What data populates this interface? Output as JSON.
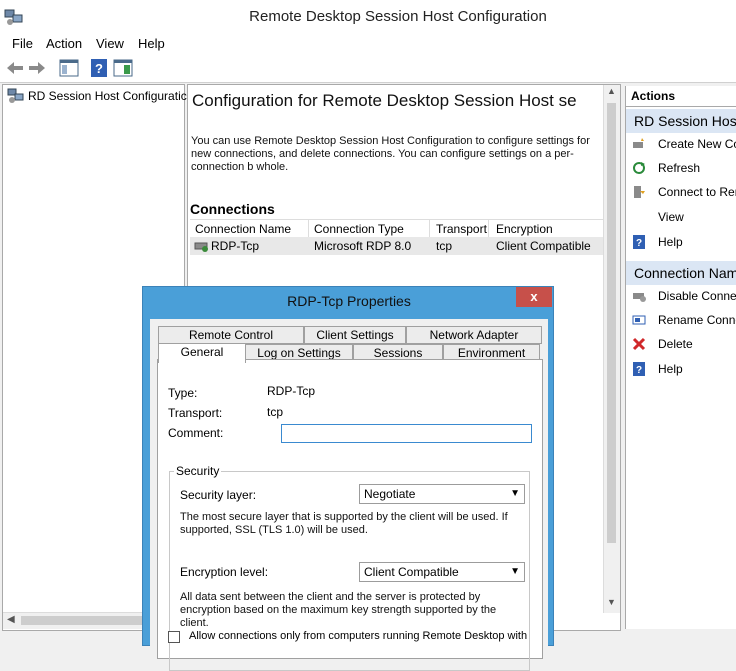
{
  "window": {
    "title": "Remote Desktop Session Host Configuration"
  },
  "menu": [
    "File",
    "Action",
    "View",
    "Help"
  ],
  "tree": {
    "root_label": "RD Session Host Configuratic"
  },
  "center": {
    "heading": "Configuration for Remote Desktop Session Host se",
    "intro": "You can use Remote Desktop Session Host Configuration to configure settings for new connections, and delete connections. You can configure settings on a per-connection b whole.",
    "connections_title": "Connections",
    "columns": [
      "Connection Name",
      "Connection Type",
      "Transport",
      "Encryption"
    ],
    "rows": [
      {
        "name": "RDP-Tcp",
        "type": "Microsoft RDP 8.0",
        "transport": "tcp",
        "encryption": "Client Compatible"
      }
    ]
  },
  "actions": {
    "header": "Actions",
    "section1": {
      "title": "RD Session Host",
      "items": [
        "Create New Co",
        "Refresh",
        "Connect to Rer",
        "View",
        "Help"
      ]
    },
    "section2": {
      "title": "Connection Nam",
      "items": [
        "Disable Connec",
        "Rename Conne",
        "Delete",
        "Help"
      ]
    }
  },
  "dialog": {
    "title": "RDP-Tcp Properties",
    "close_label": "x",
    "tabs_back": [
      "Remote Control",
      "Client Settings",
      "Network Adapter"
    ],
    "tabs_front": [
      "General",
      "Log on Settings",
      "Sessions",
      "Environment"
    ],
    "type_label": "Type:",
    "type_value": "RDP-Tcp",
    "transport_label": "Transport:",
    "transport_value": "tcp",
    "comment_label": "Comment:",
    "comment_value": "",
    "security_group": "Security",
    "security_layer_label": "Security layer:",
    "security_layer_value": "Negotiate",
    "security_layer_desc": "The most secure layer that is supported by the client will be used. If supported, SSL (TLS 1.0) will be used.",
    "encryption_label": "Encryption level:",
    "encryption_value": "Client Compatible",
    "encryption_desc": "All data sent between the client and the server is protected by encryption based on the maximum key strength supported by the client.",
    "nla_checkbox_label": "Allow connections only from computers running Remote Desktop with"
  },
  "colors": {
    "accent": "#4a9fd8",
    "section_header": "#dbe6f4",
    "close": "#c7504a"
  }
}
